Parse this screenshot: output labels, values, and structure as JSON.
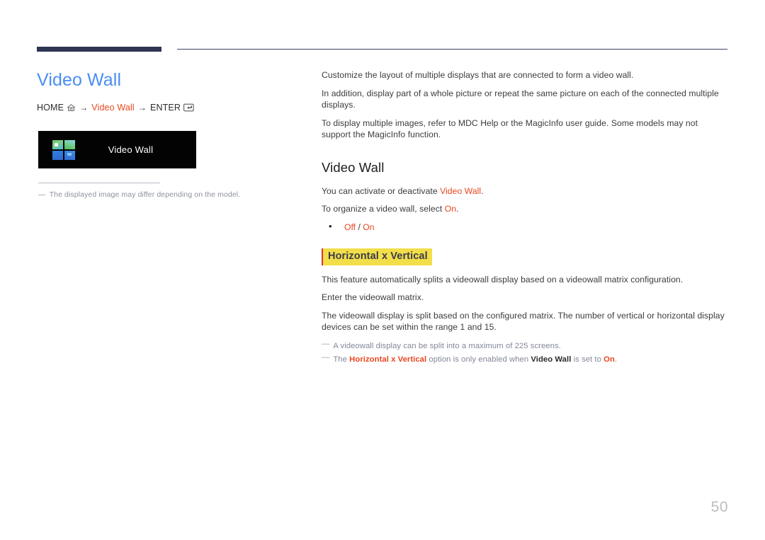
{
  "document": {
    "page_number": "50",
    "accent_blue": "#4a8ef4",
    "accent_red": "#e8471f",
    "highlight_yellow": "#f2de48",
    "rule_navy": "#2e3553"
  },
  "left": {
    "title": "Video Wall",
    "breadcrumb": {
      "home_label": "HOME",
      "home_icon": "home-icon",
      "arrow1": "→",
      "middle_label": "Video Wall",
      "arrow2": "→",
      "enter_label": "ENTER",
      "enter_icon": "enter-key-icon"
    },
    "menu_item": {
      "icon": "video-wall-grid-icon",
      "label": "Video Wall"
    },
    "note": {
      "dash": "―",
      "text": "The displayed image may differ depending on the model."
    }
  },
  "right": {
    "intro_paragraphs": [
      "Customize the layout of multiple displays that are connected to form a video wall.",
      "In addition, display part of a whole picture or repeat the same picture on each of the connected multiple displays."
    ],
    "intro_paragraph_3": {
      "text": "To display multiple images, refer to MDC Help or the MagicInfo user guide. Some models may not support the MagicInfo function."
    },
    "section": {
      "heading": "Video Wall",
      "line1_pre": "You can activate or deactivate ",
      "line1_term": "Video Wall",
      "line1_post": ".",
      "line2_pre": "To organize a video wall, select ",
      "line2_term": "On",
      "line2_post": ".",
      "options": {
        "off": "Off",
        "separator": "/",
        "on": "On"
      }
    },
    "subsection": {
      "heading": "Horizontal x Vertical",
      "paragraphs": [
        "This feature automatically splits a videowall display based on a videowall matrix configuration.",
        "Enter the videowall matrix.",
        "The videowall display is split based on the configured matrix. The number of vertical or horizontal display devices can be set within the range 1 and 15."
      ],
      "notes": [
        {
          "dash": "―",
          "text": "A videowall display can be split into a maximum of 225 screens."
        }
      ],
      "note2": {
        "dash": "―",
        "pre": "The ",
        "term1": "Horizontal x Vertical",
        "mid": " option is only enabled when ",
        "term2": "Video Wall",
        "mid2": " is set to ",
        "term3": "On",
        "post": "."
      }
    }
  }
}
